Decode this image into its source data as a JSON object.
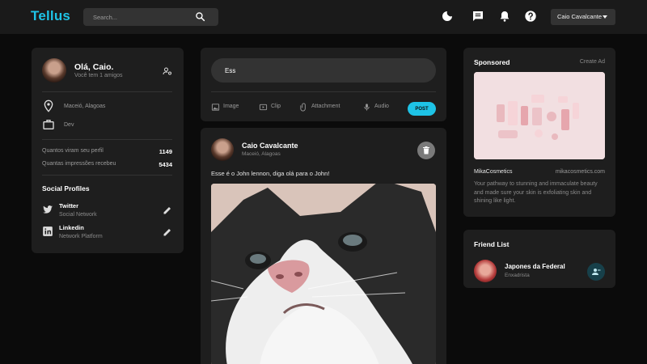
{
  "navbar": {
    "logo": "Tellus",
    "search_placeholder": "Search...",
    "user_name": "Caio Cavalcante",
    "icons": [
      "moon-icon",
      "chat-icon",
      "bell-icon",
      "help-icon"
    ]
  },
  "profile": {
    "greeting": "Olá, Caio.",
    "friends_count": "Você tem 1 amigos",
    "location": "Maceió, Alagoas",
    "occupation": "Dev",
    "stats": [
      {
        "label": "Quantos viram seu perfil",
        "value": "1149"
      },
      {
        "label": "Quantas impressões recebeu",
        "value": "5434"
      }
    ],
    "social_title": "Social Profiles",
    "social": [
      {
        "name": "Twitter",
        "sub": "Social Network",
        "icon": "twitter-icon"
      },
      {
        "name": "Linkedin",
        "sub": "Network Platform",
        "icon": "linkedin-icon"
      }
    ]
  },
  "composer": {
    "input_value": "Ess",
    "attachments": [
      {
        "label": "Image",
        "icon": "image-icon"
      },
      {
        "label": "Clip",
        "icon": "clip-icon"
      },
      {
        "label": "Attachment",
        "icon": "paperclip-icon"
      },
      {
        "label": "Audio",
        "icon": "microphone-icon"
      }
    ],
    "post_label": "POST"
  },
  "post": {
    "author": "Caio Cavalcante",
    "location": "Maceió, Alagoas",
    "text": "Esse é o John lennon, diga olá para o John!"
  },
  "sponsored": {
    "title": "Sponsored",
    "create_ad": "Create Ad",
    "brand": "MikaCosmetics",
    "url": "mikacosmetics.com",
    "description": "Your pathway to stunning and immaculate beauty and made sure your skin is exfoliating skin and shining like light."
  },
  "friend_list": {
    "title": "Friend List",
    "friends": [
      {
        "name": "Japones da Federal",
        "sub": "Enxadrista"
      }
    ]
  },
  "colors": {
    "accent": "#1ec3e6",
    "background": "#0b0b0b",
    "card": "#1e1e1e",
    "navbar": "#1a1a1a"
  }
}
